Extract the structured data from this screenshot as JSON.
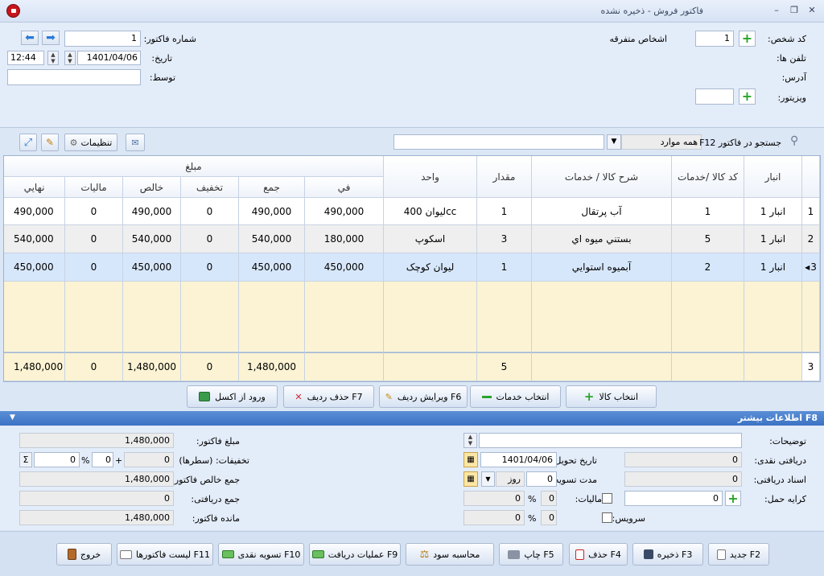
{
  "window": {
    "title": "فاکتور فروش - ذخیره نشده",
    "minimize": "–",
    "restore": "❐",
    "close": "✕"
  },
  "header": {
    "invoice_no_label": "شماره فاکتور:",
    "invoice_no": "1",
    "date_label": "تاریخ:",
    "date": "1401/04/06",
    "time": "12:44",
    "by_label": "توسط:",
    "by_value": "",
    "person_code_label": "کد شخص:",
    "person_code": "1",
    "person_name": "اشخاص متفرقه",
    "phones_label": "تلفن ها:",
    "address_label": "آدرس:",
    "visitor_label": "ویزیتور:",
    "visitor_value": ""
  },
  "toolbar": {
    "search_label": "جستجو در فاکتور F12",
    "search_scope": "همه موارد",
    "search_value": "",
    "settings_label": "تنظیمات"
  },
  "grid": {
    "group_header": "مبلغ",
    "columns": {
      "warehouse": "انبار",
      "code": "کد کالا /خدمات",
      "desc": "شرح کالا / خدمات",
      "qty": "مقدار",
      "unit": "واحد",
      "fee": "في",
      "sum": "جمع",
      "discount": "تخفيف",
      "net": "خالص",
      "tax": "ماليات",
      "final": "نهايي"
    },
    "rows": [
      {
        "n": "1",
        "warehouse": "انبار 1",
        "code": "1",
        "desc": "آب پرتقال",
        "qty": "1",
        "unit": "ليوان 400cc",
        "fee": "490,000",
        "sum": "490,000",
        "discount": "0",
        "net": "490,000",
        "tax": "0",
        "final": "490,000"
      },
      {
        "n": "2",
        "warehouse": "انبار 1",
        "code": "5",
        "desc": "بستني ميوه اي",
        "qty": "3",
        "unit": "اسکوپ",
        "fee": "180,000",
        "sum": "540,000",
        "discount": "0",
        "net": "540,000",
        "tax": "0",
        "final": "540,000"
      },
      {
        "n": "3",
        "warehouse": "انبار 1",
        "code": "2",
        "desc": "آبميوه استوايي",
        "qty": "1",
        "unit": "ليوان کوچک",
        "fee": "450,000",
        "sum": "450,000",
        "discount": "0",
        "net": "450,000",
        "tax": "0",
        "final": "450,000"
      }
    ],
    "footer": {
      "n": "3",
      "qty": "5",
      "sum": "1,480,000",
      "discount": "0",
      "net": "1,480,000",
      "tax": "0",
      "final": "1,480,000"
    }
  },
  "actions": {
    "select_goods": "انتخاب کالا",
    "select_services": "انتخاب خدمات",
    "edit_row": "ویرایش ردیف F6",
    "delete_row": "حذف ردیف F7",
    "import_excel": "ورود از اکسل"
  },
  "more_info": {
    "label": "F8 اطلاعات بیشتر"
  },
  "info": {
    "notes_label": "توضیحات:",
    "notes_value": "",
    "cash_label": "دریافتی نقدی:",
    "cash_value": "0",
    "delivery_label": "تاریخ تحویل:",
    "delivery_value": "1401/04/06",
    "docs_label": "اسناد دریافتی:",
    "docs_value": "0",
    "settle_label": "مدت تسویه:",
    "settle_value": "0",
    "settle_unit": "روز",
    "freight_label": "کرایه حمل:",
    "freight_value": "0",
    "tax_label": "مالیات:",
    "tax_value": "0",
    "tax_pct": "0",
    "service_label": "سرویس:",
    "service_value": "0",
    "service_pct": "0",
    "amount_label": "مبلغ فاکتور:",
    "amount_value": "1,480,000",
    "discounts_label": "تخفیفات: (سطرها)",
    "discounts_value": "0",
    "disc_plus": "+",
    "disc_extra": "0",
    "disc_pct_sign": "%",
    "disc_pct": "0",
    "net_label": "جمع خالص فاکتور:",
    "net_value": "1,480,000",
    "received_label": "جمع دریافتی:",
    "received_value": "0",
    "remain_label": "مانده فاکتور:",
    "remain_value": "1,480,000",
    "pct_sign": "%",
    "sigma": "Σ"
  },
  "bottom": {
    "new": "جدید F2",
    "save": "ذخیره F3",
    "delete": "حذف F4",
    "print": "چاپ F5",
    "profit": "محاسبه سود",
    "receive": "عملیات دریافت F9",
    "settle": "تسویه نقدی F10",
    "list": "لیست فاکتورها F11",
    "exit": "خروج"
  }
}
